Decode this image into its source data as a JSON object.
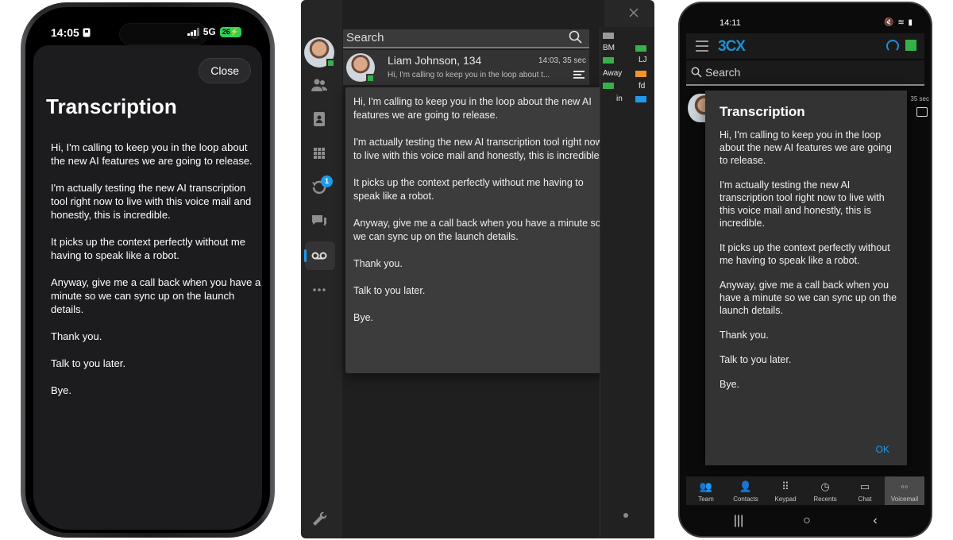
{
  "message_paragraphs": [
    "Hi, I'm calling to keep you in the loop about the new AI features we are going to release.",
    "I'm actually testing the new AI transcription tool right now to live with this voice mail and honestly, this is incredible.",
    "It picks up the context perfectly without me having to speak like a robot.",
    "Anyway, give me a call back when you have a minute so we can sync up on the launch details.",
    "Thank you.",
    "Talk to you later.",
    "Bye."
  ],
  "ios": {
    "time": "14:05",
    "network": "5G",
    "battery": "26",
    "close_label": "Close",
    "title": "Transcription"
  },
  "windows": {
    "search_placeholder": "Search",
    "voicemail": {
      "contact": "Liam Johnson, 134",
      "time": "14:03, 35 sec",
      "preview": "Hi, I'm calling to keep you in the loop about t..."
    },
    "recents_badge": "1",
    "side_labels": [
      "BM",
      "LJ",
      "Away",
      "fd",
      "in"
    ],
    "colors": {
      "green": "#35b04a",
      "orange": "#f0932b",
      "blue": "#1e9be8",
      "gray": "#9a9a9a"
    }
  },
  "android": {
    "time": "14:11",
    "app_logo": "3CX",
    "search_placeholder": "Search",
    "list_time": "35 sec",
    "dialog_title": "Transcription",
    "ok_label": "OK",
    "nav": [
      {
        "label": "Team",
        "icon": "team-icon"
      },
      {
        "label": "Contacts",
        "icon": "contacts-icon"
      },
      {
        "label": "Keypad",
        "icon": "keypad-icon"
      },
      {
        "label": "Recents",
        "icon": "recents-icon"
      },
      {
        "label": "Chat",
        "icon": "chat-icon"
      },
      {
        "label": "Voicemail",
        "icon": "voicemail-icon"
      }
    ],
    "active_tab": "Voicemail"
  }
}
